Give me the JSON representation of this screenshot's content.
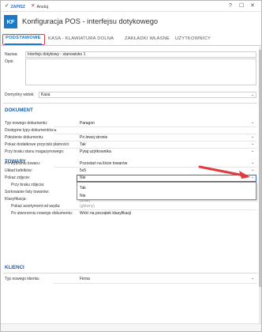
{
  "toolbar": {
    "save_label": "ZAPISZ",
    "cancel_label": "Anuluj",
    "help_label": "?",
    "minimize_label": "—",
    "maximize_label": "☐",
    "close_label": "✕"
  },
  "header": {
    "logo_text": "KF",
    "title": "Konfiguracja POS - interfejsu dotykowego"
  },
  "tabs": [
    {
      "label": "PODSTAWOWE",
      "active": true
    },
    {
      "label": "KASA - KLAWIATURA DOLNA",
      "active": false
    },
    {
      "label": "ZAKŁADKI WŁASNE",
      "active": false
    },
    {
      "label": "UŻYTKOWNICY",
      "active": false
    }
  ],
  "general": {
    "name_label": "Nazwa:",
    "name_value": "Interfejs dotykowy - stanowisko 1",
    "desc_label": "Opis:",
    "desc_value": "",
    "default_view_label": "Domyślny widok:",
    "default_view_value": "Kasa"
  },
  "dokument": {
    "title": "DOKUMENT",
    "rows": [
      {
        "label": "Typ nowego dokumentu:",
        "value": "Paragon"
      },
      {
        "label": "Dostępne typy dokumentów ▸",
        "value": ""
      },
      {
        "label": "Położenie dokumentu:",
        "value": "Po lewej stronie"
      },
      {
        "label": "Pokaż dodatkowe przyciski płatności:",
        "value": "Tak"
      },
      {
        "label": "Przy braku stanu magazynowego:",
        "value": "Pytaj użytkownika"
      }
    ]
  },
  "towary": {
    "title": "TOWARY",
    "rows": [
      {
        "label": "Po wybraniu towaru:",
        "value": "Pozostań na liście towarów"
      },
      {
        "label": "Układ kafelków:",
        "value": "5x5"
      },
      {
        "label": "Pokaż zdjęcie:",
        "value": "Nie"
      },
      {
        "label": "Przy braku zdjęcia:",
        "value": ""
      },
      {
        "label": "Sortowanie listy towarów:",
        "value": ""
      },
      {
        "label": "Klasyfikacja:",
        "value": "(brak)"
      },
      {
        "label": "Pokaż asortyment od węzła:",
        "value": "(główny)"
      },
      {
        "label": "Po utworzeniu nowego dokumentu:",
        "value": "Wróć na początek klasyfikacji"
      }
    ],
    "dropdown_options": [
      "Tak",
      "Nie"
    ]
  },
  "klienci": {
    "title": "KLIENCI",
    "rows": [
      {
        "label": "Typ nowego klienta:",
        "value": "Firma"
      }
    ]
  },
  "colors": {
    "accent": "#1c79c7",
    "section": "#1c5ea8",
    "highlight": "#e03c3c"
  }
}
